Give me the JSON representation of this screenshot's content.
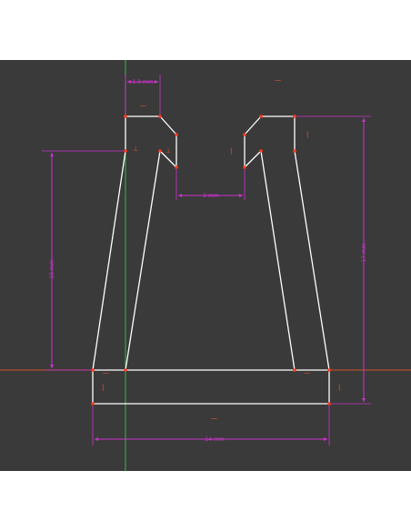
{
  "sketch": {
    "dimensions": {
      "top_left_width": "1.3 mm",
      "slot_width": "2 mm",
      "left_height": "10 mm",
      "right_height": "17 mm",
      "bottom_width": "14 mm"
    },
    "colors": {
      "background": "#3a3a3a",
      "geometry": "#ffffff",
      "dimension": "#cc33cc",
      "x_axis": "#d0512a",
      "y_axis": "#39b54a",
      "vertex": "#ff3b1f"
    },
    "constraint_symbols": {
      "horizontal": "—",
      "vertical": "|",
      "perpendicular": "⊥"
    }
  }
}
